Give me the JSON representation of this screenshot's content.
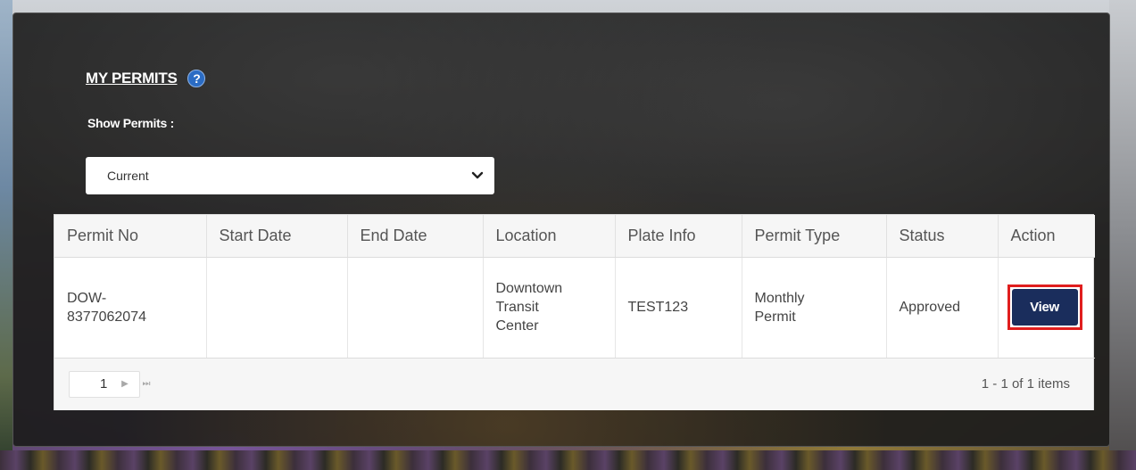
{
  "permits_panel": {
    "title": "MY PERMITS",
    "help_icon": "?",
    "show_label": "Show Permits :",
    "filter": {
      "selected": "Current"
    }
  },
  "table": {
    "columns": [
      "Permit No",
      "Start Date",
      "End Date",
      "Location",
      "Plate Info",
      "Permit Type",
      "Status",
      "Action"
    ],
    "rows": [
      {
        "permit_no_line1": "DOW-",
        "permit_no_line2": "8377062074",
        "start_date": "",
        "end_date": "",
        "location_line1": "Downtown",
        "location_line2": "Transit",
        "location_line3": "Center",
        "plate_info": "TEST123",
        "permit_type_line1": "Monthly",
        "permit_type_line2": "Permit",
        "status": "Approved",
        "action_label": "View"
      }
    ]
  },
  "pager": {
    "current_page": "1",
    "next_icon": "▶",
    "last_icon": "⏭",
    "info": "1 - 1 of 1 items"
  },
  "colors": {
    "view_button": "#1a2d5c",
    "highlight": "#e01e1e",
    "help_icon": "#2b6cc4"
  }
}
